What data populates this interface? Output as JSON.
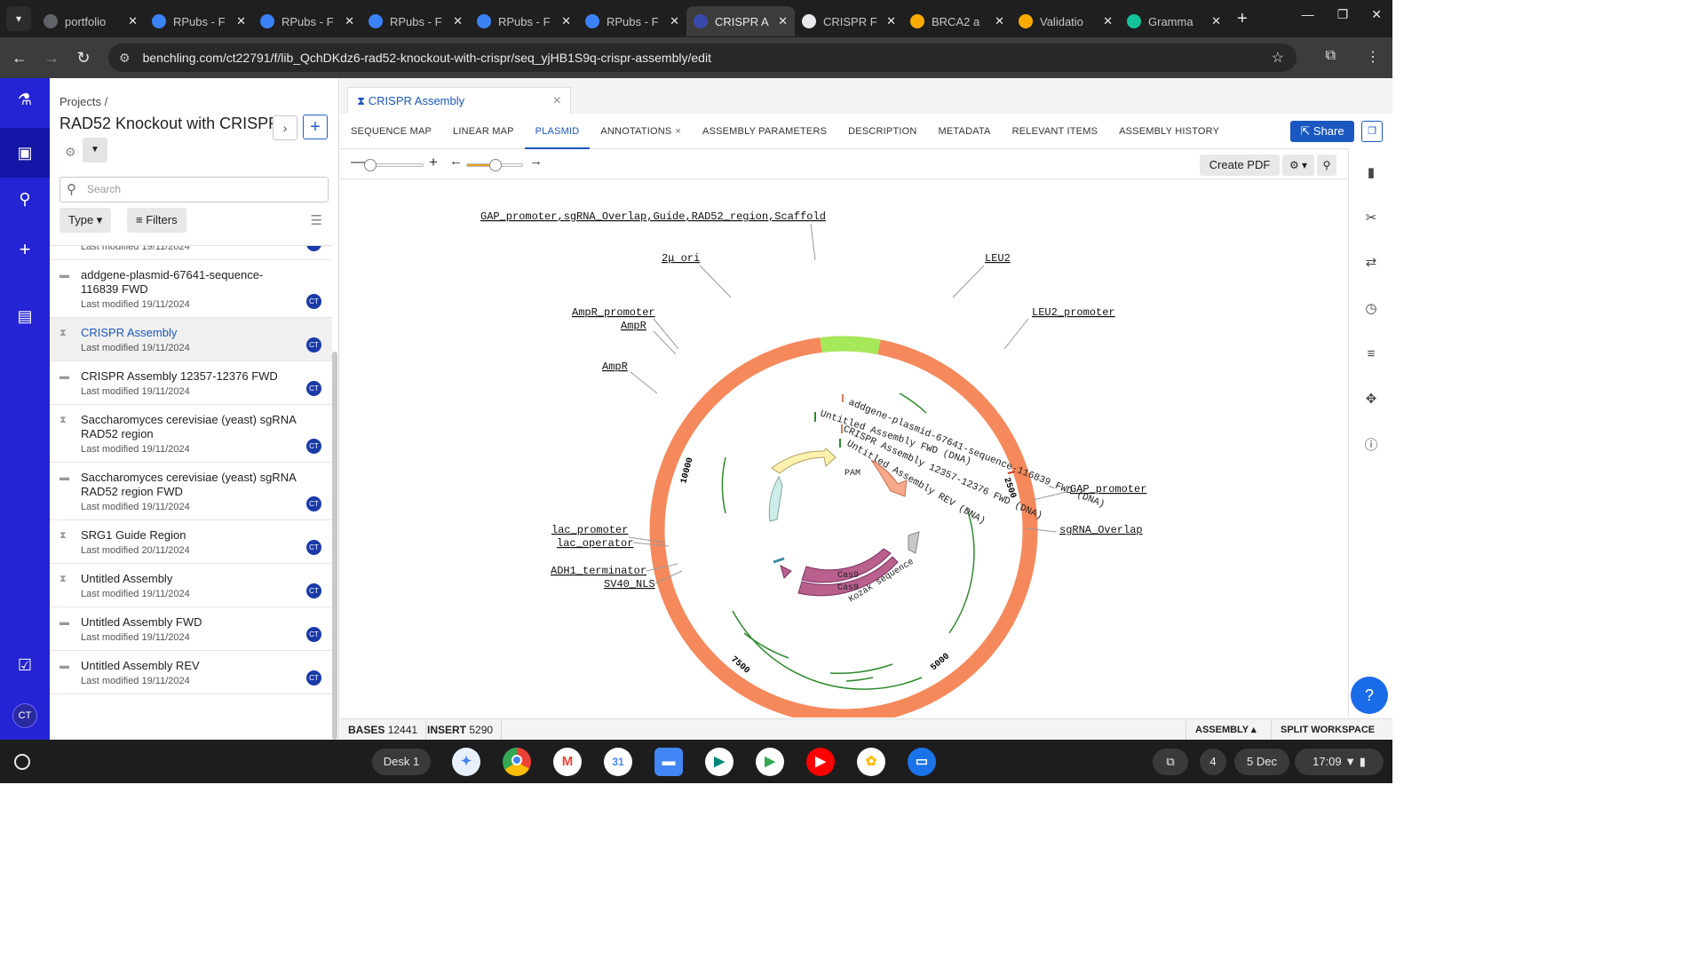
{
  "browser": {
    "tabs": [
      {
        "label": "portfolio",
        "icon": "github-icon",
        "color": "#5f6368"
      },
      {
        "label": "RPubs - F",
        "icon": "rpubs-icon",
        "color": "#3b82f6"
      },
      {
        "label": "RPubs - F",
        "icon": "rpubs-icon",
        "color": "#3b82f6"
      },
      {
        "label": "RPubs - F",
        "icon": "rpubs-icon",
        "color": "#3b82f6"
      },
      {
        "label": "RPubs - F",
        "icon": "rpubs-icon",
        "color": "#3b82f6"
      },
      {
        "label": "RPubs - F",
        "icon": "rpubs-icon",
        "color": "#3b82f6"
      },
      {
        "label": "CRISPR A",
        "icon": "benchling-icon",
        "color": "#3949ab",
        "active": true
      },
      {
        "label": "CRISPR F",
        "icon": "chatgpt-icon",
        "color": "#e8eaed"
      },
      {
        "label": "BRCA2 a",
        "icon": "colab-icon",
        "color": "#f9ab00"
      },
      {
        "label": "Validatio",
        "icon": "colab-icon",
        "color": "#f9ab00"
      },
      {
        "label": "Gramma",
        "icon": "grammarly-icon",
        "color": "#15c39a"
      }
    ],
    "url": "benchling.com/ct22791/f/lib_QchDKdz6-rad52-knockout-with-crispr/seq_yjHB1S9q-crispr-assembly/edit"
  },
  "rail": {
    "avatar_initials": "CT",
    "brand_color": "#2424d4"
  },
  "panel": {
    "breadcrumb": "Projects /",
    "title": "RAD52 Knockout with CRISPR",
    "search_placeholder": "Search",
    "type_label": "Type",
    "filters_label": "Filters",
    "files": [
      {
        "name": "",
        "date": "Last modified 19/11/2024",
        "kind": "dna"
      },
      {
        "name": "addgene-plasmid-67641-sequence-116839 FWD",
        "date": "Last modified 19/11/2024",
        "kind": "dna"
      },
      {
        "name": "CRISPR Assembly",
        "date": "Last modified 19/11/2024",
        "kind": "assembly",
        "selected": true
      },
      {
        "name": "CRISPR Assembly 12357-12376 FWD",
        "date": "Last modified 19/11/2024",
        "kind": "dna"
      },
      {
        "name": "Saccharomyces cerevisiae (yeast) sgRNA RAD52 region",
        "date": "Last modified 19/11/2024",
        "kind": "assembly"
      },
      {
        "name": "Saccharomyces cerevisiae (yeast) sgRNA RAD52 region FWD",
        "date": "Last modified 19/11/2024",
        "kind": "dna"
      },
      {
        "name": "SRG1 Guide Region",
        "date": "Last modified 20/11/2024",
        "kind": "assembly"
      },
      {
        "name": "Untitled Assembly",
        "date": "Last modified 19/11/2024",
        "kind": "assembly"
      },
      {
        "name": "Untitled Assembly FWD",
        "date": "Last modified 19/11/2024",
        "kind": "dna"
      },
      {
        "name": "Untitled Assembly REV",
        "date": "Last modified 19/11/2024",
        "kind": "dna"
      }
    ],
    "owner_initials": "CT"
  },
  "main": {
    "doc_tab": "CRISPR Assembly",
    "subtabs": [
      "Sequence Map",
      "Linear Map",
      "Plasmid",
      "Annotations",
      "Assembly Parameters",
      "Description",
      "Metadata",
      "Relevant Items",
      "Assembly History"
    ],
    "active_subtab": "Plasmid",
    "share_label": "Share",
    "create_pdf_label": "Create PDF",
    "zoom_level": 0.05,
    "rotation_level": 0.5,
    "accent_color": "#1a57c0"
  },
  "plasmid": {
    "backbone_color": "#f5895c",
    "highlight_color": "#a5e85a",
    "ticks": [
      "2500",
      "5000",
      "7500",
      "10000"
    ],
    "feature_labels": {
      "top_group": [
        "GAP_promoter",
        "sgRNA_Overlap",
        "Guide",
        "RAD52_region",
        "Scaffold"
      ],
      "two_mu_ori": "2μ ori",
      "leu2": "LEU2",
      "leu2_promoter": "LEU2_promoter",
      "ampr_promoter": "AmpR_promoter",
      "ampr_a": "AmpR",
      "ampr_b": "AmpR",
      "gap_promoter": "GAP_promoter",
      "sgrna_overlap": "sgRNA_Overlap",
      "lac_promoter": "lac_promoter",
      "lac_operator": "lac_operator",
      "adh1_terminator": "ADH1_terminator",
      "sv40_nls": "SV40_NLS"
    },
    "inner_labels": {
      "addgene": "addgene-plasmid-67641-sequence-116839_FWD (DNA)",
      "untitled_fwd": "Untitled Assembly FWD (DNA)",
      "crispr_fwd": "CRISPR Assembly 12357-12376 FWD (DNA)",
      "untitled_rev": "Untitled Assembly REV (DNA)",
      "pam": "PAM",
      "cas9_a": "Cas9",
      "cas9_b": "Cas9",
      "kozak": "Kozak sequence"
    }
  },
  "status": {
    "bases_label": "BASES",
    "bases": "12441",
    "insert_label": "INSERT",
    "insert": "5290",
    "assembly_label": "ASSEMBLY",
    "split_label": "SPLIT WORKSPACE"
  },
  "shelf": {
    "desk_label": "Desk 1",
    "notif_count": "4",
    "date": "5 Dec",
    "time": "17:09"
  }
}
